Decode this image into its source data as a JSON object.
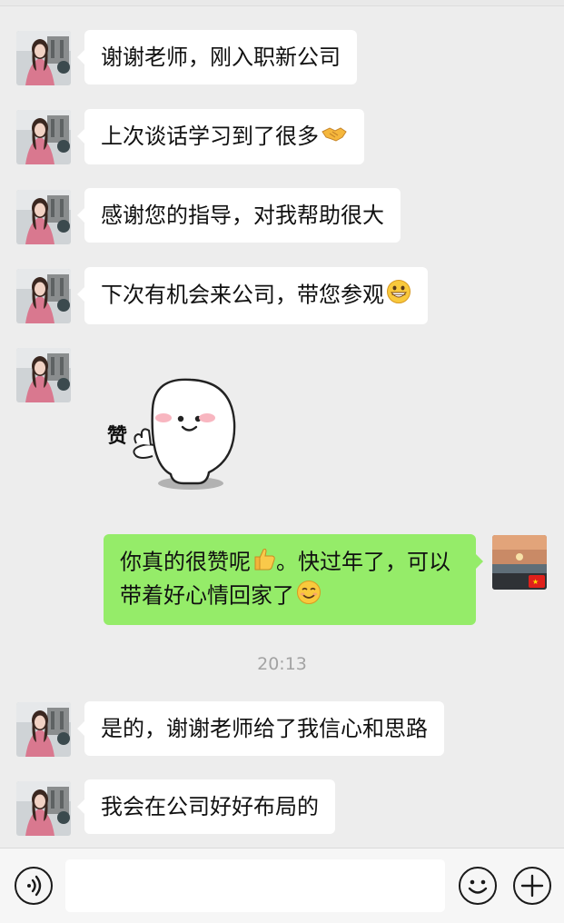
{
  "messages": [
    {
      "side": "left",
      "text": "谢谢老师，刚入职新公司",
      "emoji": ""
    },
    {
      "side": "left",
      "text": "上次谈话学习到了很多",
      "emoji": "handshake-icon"
    },
    {
      "side": "left",
      "text": "感谢您的指导，对我帮助很大",
      "emoji": ""
    },
    {
      "side": "left",
      "text": "下次有机会来公司，带您参观",
      "emoji": "grinning-face-icon"
    },
    {
      "side": "left",
      "type": "sticker",
      "sticker_text": "赞"
    },
    {
      "side": "right",
      "text_part1": "你真的很赞呢",
      "text_part2": "。快过年了，可以带着好心情回家了"
    },
    {
      "side": "left",
      "text": "是的，谢谢老师给了我信心和思路",
      "emoji": ""
    },
    {
      "side": "left",
      "text": "我会在公司好好布局的",
      "emoji": ""
    }
  ],
  "timestamp": "20:13",
  "colors": {
    "background": "#ededed",
    "bubble_left": "#ffffff",
    "bubble_right": "#95ec69"
  }
}
